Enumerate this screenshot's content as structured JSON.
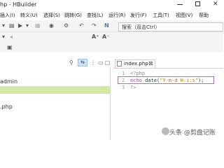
{
  "window": {
    "title": "hp - HBuilder"
  },
  "menu": {
    "items": [
      {
        "label": "插入(I)"
      },
      {
        "label": "转义(U)"
      },
      {
        "label": "选择(S)"
      },
      {
        "label": "跳转(G)"
      },
      {
        "label": "查找(L)"
      },
      {
        "label": "运行(R)"
      },
      {
        "label": "发行(F)"
      },
      {
        "label": "工具(T)"
      },
      {
        "label": "视图(V)"
      },
      {
        "label": "帮助"
      }
    ]
  },
  "search": {
    "placeholder": "搜索（双击Ctrl）"
  },
  "project_tree": {
    "items": [
      {
        "label": "admin"
      },
      {
        "label": ".php"
      }
    ]
  },
  "editor": {
    "tab_label": "index.php",
    "lines": [
      {
        "number": "1",
        "code": "<?php"
      },
      {
        "number": "2",
        "keyword": "echo",
        "func": "date(",
        "string": "\"Y-m-d H:i:s\"",
        "tail": ");"
      },
      {
        "number": "3",
        "code": "?>"
      }
    ]
  },
  "watermark": {
    "text": "头条 @剪盘记账"
  }
}
